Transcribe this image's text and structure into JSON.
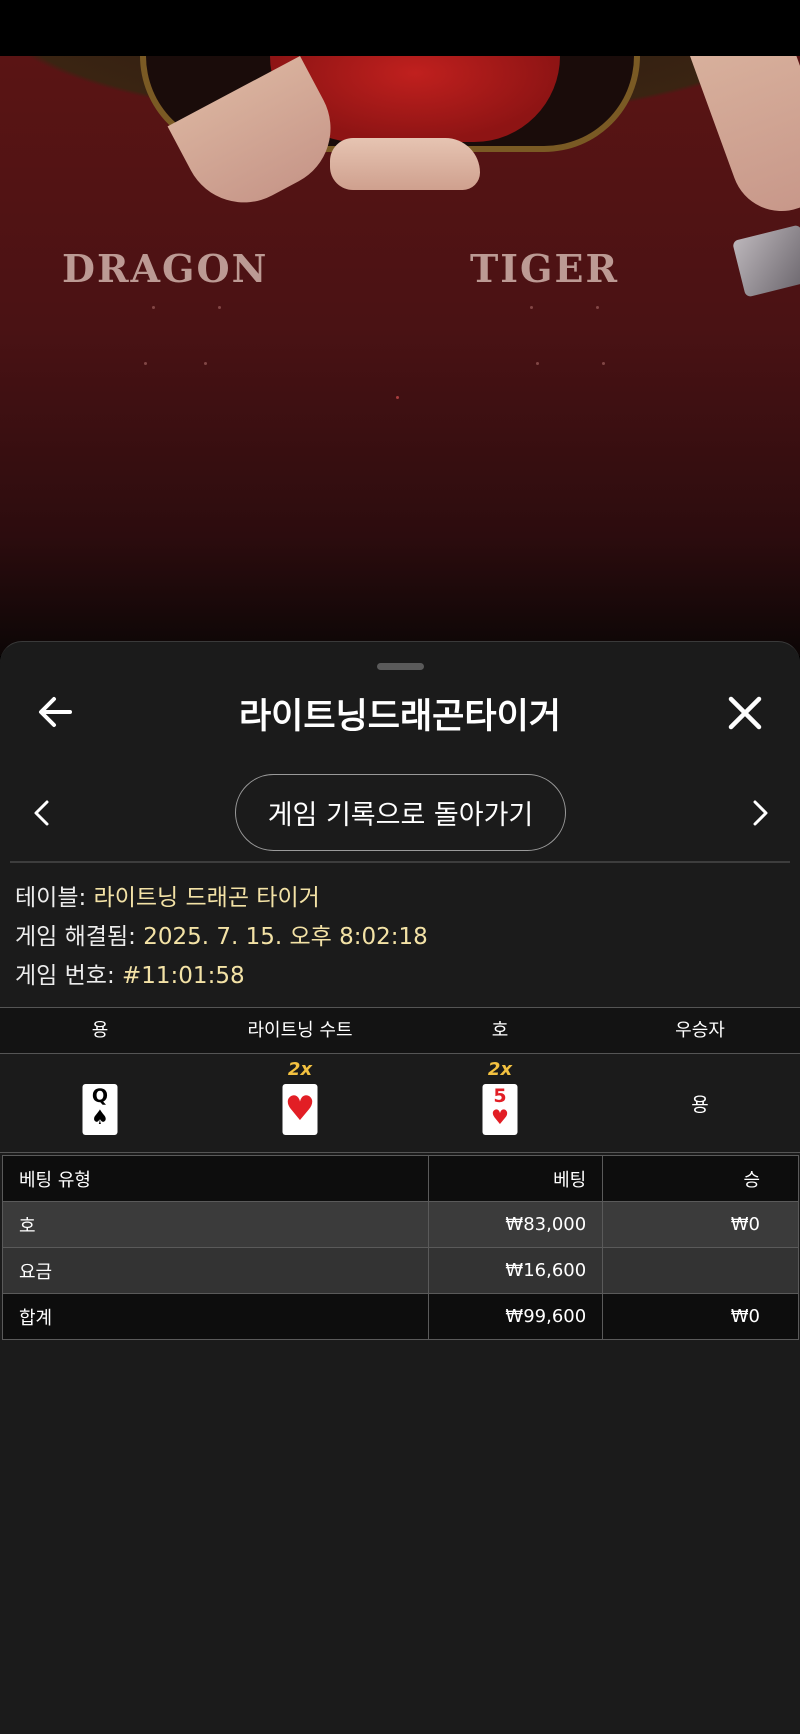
{
  "video": {
    "felt_left_label": "DRAGON",
    "felt_right_label": "TIGER"
  },
  "header": {
    "title": "라이트닝드래곤타이거",
    "back_icon": "arrow-left-icon",
    "close_icon": "close-icon"
  },
  "nav": {
    "history_button": "게임 기록으로 돌아가기",
    "prev_icon": "chevron-left-icon",
    "next_icon": "chevron-right-icon"
  },
  "info": {
    "table_label": "테이블:",
    "table_value": "라이트닝 드래곤 타이거",
    "resolved_label": "게임 해결됨:",
    "resolved_value": "2025. 7. 15. 오후 8:02:18",
    "round_label": "게임 번호:",
    "round_value": "#11:01:58"
  },
  "results": {
    "headers": [
      "용",
      "라이트닝 수트",
      "호",
      "우승자"
    ],
    "dragon_card": {
      "rank": "Q",
      "suit": "♠",
      "color": "#000000"
    },
    "lightning_suit": {
      "multiplier": "2x",
      "suit": "♥",
      "color": "#e21e25"
    },
    "tiger_card": {
      "multiplier": "2x",
      "rank": "5",
      "suit": "♥",
      "color": "#e21e25"
    },
    "winner": "용"
  },
  "bets": {
    "headers": {
      "type": "베팅 유형",
      "bet": "베팅",
      "win": "승"
    },
    "rows": [
      {
        "type": "호",
        "bet": "₩83,000",
        "win": "₩0"
      },
      {
        "type": "요금",
        "bet": "₩16,600",
        "win": ""
      },
      {
        "type": "합계",
        "bet": "₩99,600",
        "win": "₩0"
      }
    ]
  },
  "colors": {
    "accent_value": "#f3e2a6",
    "multiplier": "#f3c140",
    "sheet_bg": "#1b1b1b"
  }
}
